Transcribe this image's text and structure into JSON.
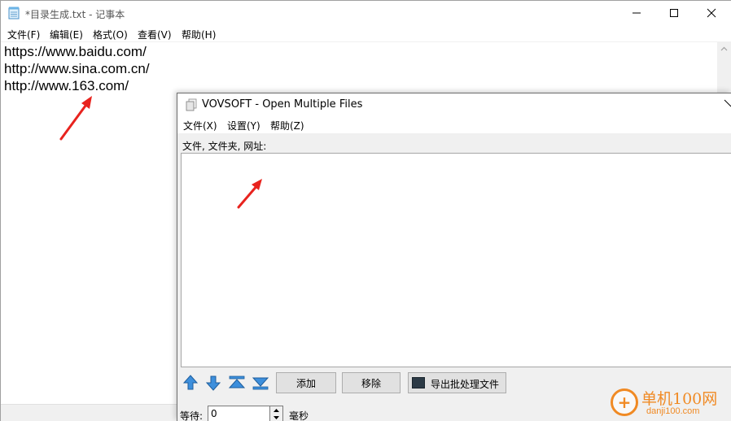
{
  "notepad": {
    "title": "*目录生成.txt - 记事本",
    "menu": [
      "文件(F)",
      "编辑(E)",
      "格式(O)",
      "查看(V)",
      "帮助(H)"
    ],
    "lines": [
      "https://www.baidu.com/",
      "http://www.sina.com.cn/",
      "http://www.163.com/"
    ]
  },
  "vovsoft": {
    "title": "VOVSOFT - Open Multiple Files",
    "menu": [
      "文件(X)",
      "设置(Y)",
      "帮助(Z)"
    ],
    "list_label": "文件, 文件夹, 网址:",
    "buttons": {
      "add": "添加",
      "remove": "移除",
      "export": "导出批处理文件"
    },
    "wait_label": "等待:",
    "wait_value": "0",
    "wait_unit": "毫秒"
  },
  "watermark": {
    "text": "单机100网",
    "sub": "danji100.com"
  },
  "colors": {
    "arrow": "#e8231e",
    "arrow_button": "#2f7fd0",
    "watermark": "#f08a24"
  }
}
